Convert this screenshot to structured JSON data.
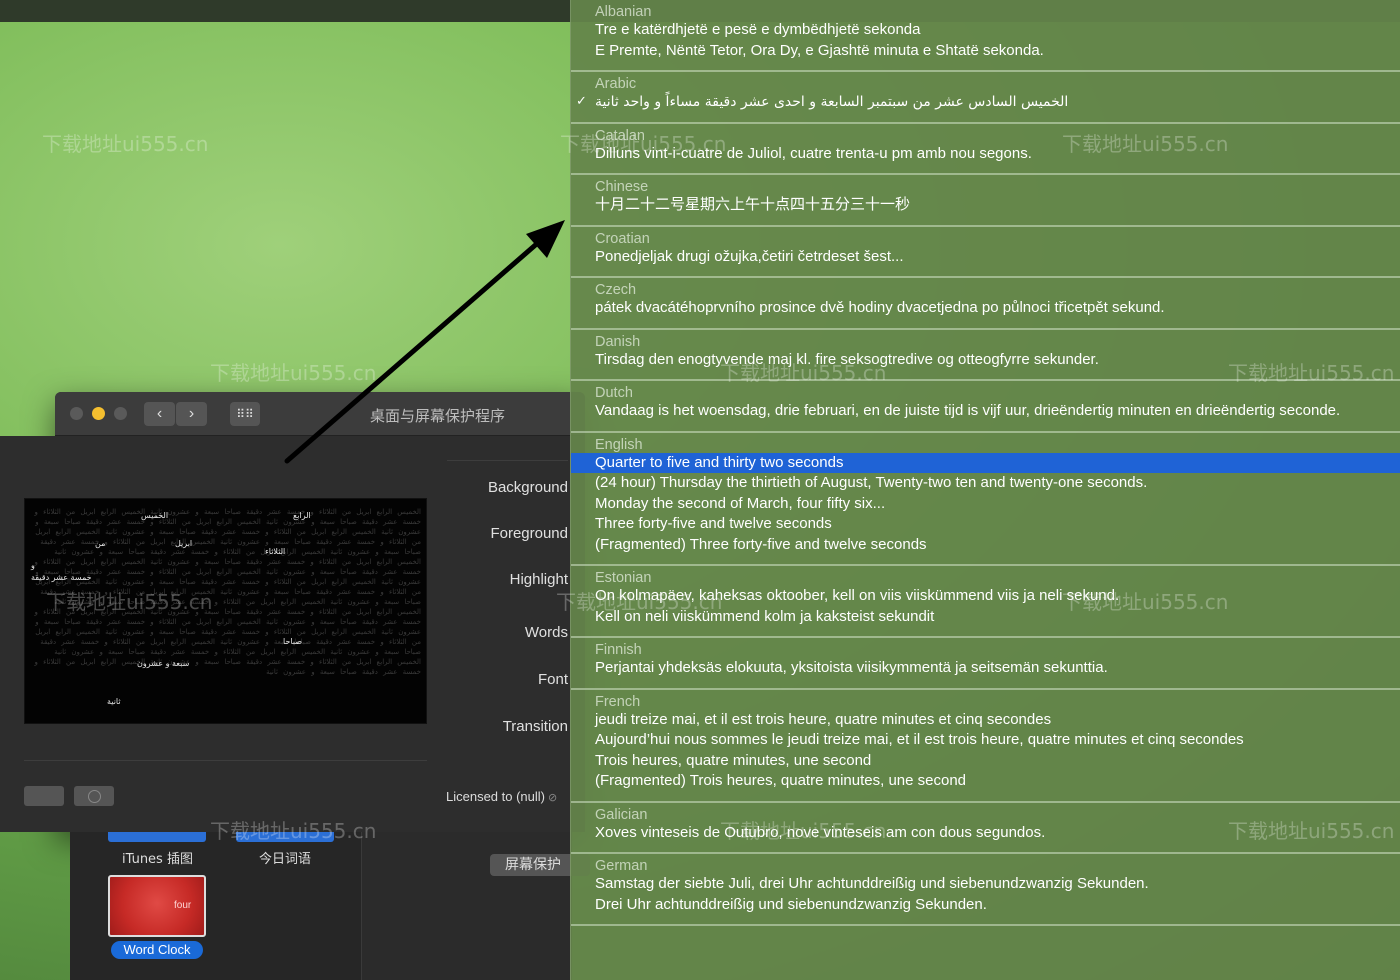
{
  "window": {
    "title": "桌面与屏幕保护程序"
  },
  "watermark": "下载地址ui555.cn",
  "options": {
    "background": "Background",
    "foreground": "Foreground",
    "highlight": "Highlight",
    "words": "Words",
    "font": "Font",
    "transition": "Transition"
  },
  "licensed": "Licensed to (null)",
  "lower": {
    "itunes_label": "iTunes 插图",
    "today_label": "今日词语",
    "word_clock_label": "Word Clock",
    "word_clock_word": "four",
    "screensaver_button": "屏幕保护"
  },
  "preview": {
    "highlights": [
      "الخميس",
      "الرابع",
      "ابريل",
      "من",
      "الثلاثاء",
      "و",
      "خمسة عشر دقيقة",
      "صباحا",
      "سبعة و عشرون",
      "ثانية"
    ]
  },
  "languages": [
    {
      "name": "Albanian",
      "formats": [
        "Tre e katërdhjetë e pesë e dymbëdhjetë sekonda",
        "E Premte, Nëntë Tetor, Ora Dy, e Gjashtë minuta e Shtatë sekonda."
      ]
    },
    {
      "name": "Arabic",
      "checked": true,
      "rtl": true,
      "formats": [
        "الخميس السادس عشر من سبتمبر السابعة و احدى عشر دقيقة مساءاً و واحد ثانية"
      ]
    },
    {
      "name": "Catalan",
      "formats": [
        "Dilluns vint-i-cuatre de Juliol, cuatre trenta-u pm amb nou segons."
      ]
    },
    {
      "name": "Chinese",
      "formats": [
        "十月二十二号星期六上午十点四十五分三十一秒"
      ]
    },
    {
      "name": "Croatian",
      "formats": [
        "Ponedjeljak drugi ožujka,četiri četrdeset šest..."
      ]
    },
    {
      "name": "Czech",
      "formats": [
        "pátek dvacátéhoprvního prosince dvě hodiny dvacetjedna po půlnoci třicetpět sekund."
      ]
    },
    {
      "name": "Danish",
      "formats": [
        "Tirsdag den enogtyvende maj kl. fire seksogtredive og otteogfyrre sekunder."
      ]
    },
    {
      "name": "Dutch",
      "formats": [
        "Vandaag is het woensdag, drie februari, en de juiste tijd is vijf uur, drieëndertig minuten en drieëndertig seconde."
      ]
    },
    {
      "name": "English",
      "selected_index": 0,
      "formats": [
        "Quarter to five and thirty two seconds",
        "(24 hour) Thursday the thirtieth of August, Twenty-two ten and twenty-one seconds.",
        "Monday the second of March, four fifty six...",
        "Three forty-five and twelve seconds",
        "(Fragmented) Three forty-five and twelve seconds"
      ]
    },
    {
      "name": "Estonian",
      "formats": [
        "On kolmapäev, kaheksas oktoober, kell on viis viiskümmend viis ja neli sekund.",
        "Kell on neli viiskümmend kolm ja kaksteist sekundit"
      ]
    },
    {
      "name": "Finnish",
      "formats": [
        "Perjantai yhdeksäs elokuuta, yksitoista viisikymmentä ja seitsemän sekunttia."
      ]
    },
    {
      "name": "French",
      "formats": [
        "jeudi treize mai, et il est trois heure, quatre minutes et cinq secondes",
        "Aujourd’hui nous sommes le jeudi treize mai, et il est trois heure, quatre minutes et cinq secondes",
        "Trois heures, quatre minutes, une second",
        "(Fragmented) Trois heures, quatre minutes, une second"
      ]
    },
    {
      "name": "Galician",
      "formats": [
        "Xoves vinteseis de Outubro, nove vinteseis am con dous segundos."
      ]
    },
    {
      "name": "German",
      "formats": [
        "Samstag der siebte Juli, drei Uhr achtunddreißig und siebenundzwanzig Sekunden.",
        "Drei Uhr achtunddreißig und siebenundzwanzig Sekunden."
      ]
    }
  ]
}
